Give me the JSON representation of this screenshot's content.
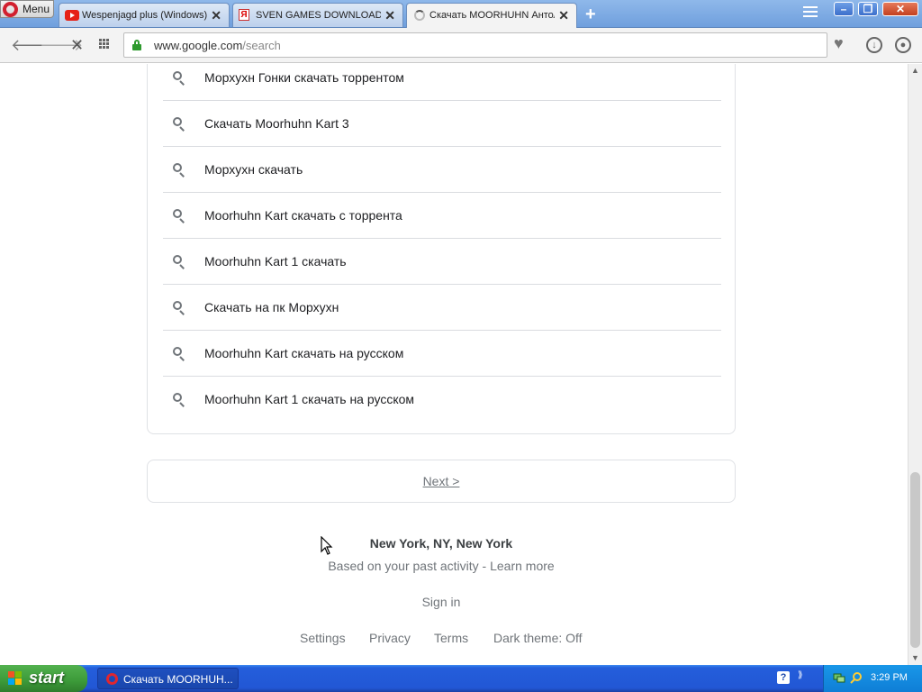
{
  "browser": {
    "menu_label": "Menu",
    "tabs": [
      {
        "label": "Wespenjagd plus (Windows)",
        "icon": "youtube-icon"
      },
      {
        "label": "SVEN GAMES DOWNLOAD —",
        "icon": "yandex-icon"
      },
      {
        "label": "Скачать MOORHUHN Антол",
        "icon": "loading-spinner-icon"
      }
    ],
    "address": {
      "domain": "www.google.com",
      "path": "/search"
    }
  },
  "page": {
    "suggestions": [
      "Морхухн Гонки скачать торрентом",
      "Скачать Moorhuhn Kart 3",
      "Морхухн скачать",
      "Moorhuhn Kart скачать с торрента",
      "Moorhuhn Kart 1 скачать",
      "Скачать на пк Морхухн",
      "Moorhuhn Kart скачать на русском",
      "Moorhuhn Kart 1 скачать на русском"
    ],
    "next_label": "Next >",
    "location": "New York, NY, New York",
    "activity_text": "Based on your past activity - Learn more",
    "sign_in": "Sign in",
    "footer": {
      "settings": "Settings",
      "privacy": "Privacy",
      "terms": "Terms",
      "dark_theme": "Dark theme: Off"
    }
  },
  "taskbar": {
    "start_label": "start",
    "task_label": "Скачать MOORHUH...",
    "clock": "3:29 PM"
  },
  "colors": {
    "taskbar_blue": "#245edb",
    "start_green": "#3c9a39",
    "secure_lock": "#2e9a2e"
  }
}
